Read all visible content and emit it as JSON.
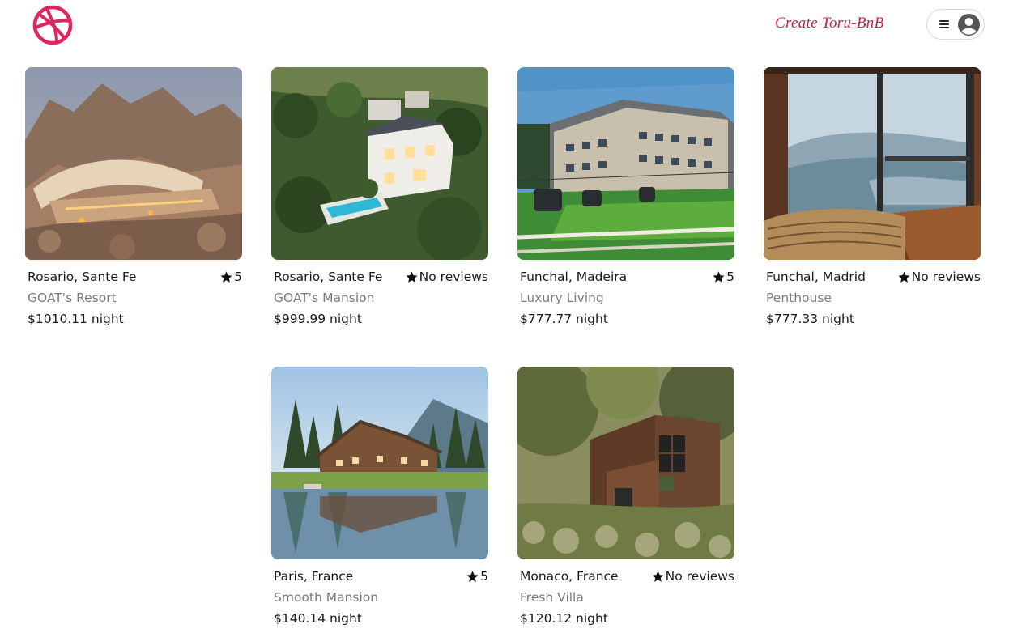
{
  "header": {
    "create_link": "Create Toru-BnB",
    "brand_color": "#e0245e",
    "logo_icon": "dribbble-ball-icon",
    "menu_icon": "hamburger-icon",
    "avatar_icon": "user-circle-icon"
  },
  "listings": [
    {
      "location": "Rosario, Sante Fe",
      "rating": "5",
      "title": "GOAT's Resort",
      "price": "$1010.11 night",
      "image": "desert-resort-photo"
    },
    {
      "location": "Rosario, Sante Fe",
      "rating": "No reviews",
      "title": "GOAT's Mansion",
      "price": "$999.99 night",
      "image": "hillside-mansion-pool-photo"
    },
    {
      "location": "Funchal, Madeira",
      "rating": "5",
      "title": "Luxury Living",
      "price": "$777.77 night",
      "image": "mountain-lodge-gondola-photo"
    },
    {
      "location": "Funchal, Madrid",
      "rating": "No reviews",
      "title": "Penthouse",
      "price": "$777.33 night",
      "image": "ocean-view-bedroom-photo"
    },
    {
      "location": "Paris, France",
      "rating": "5",
      "title": "Smooth Mansion",
      "price": "$140.14 night",
      "image": "lakeside-lodge-photo"
    },
    {
      "location": "Monaco, France",
      "rating": "No reviews",
      "title": "Fresh Villa",
      "price": "$120.12 night",
      "image": "modern-cor-ten-villa-photo"
    }
  ]
}
